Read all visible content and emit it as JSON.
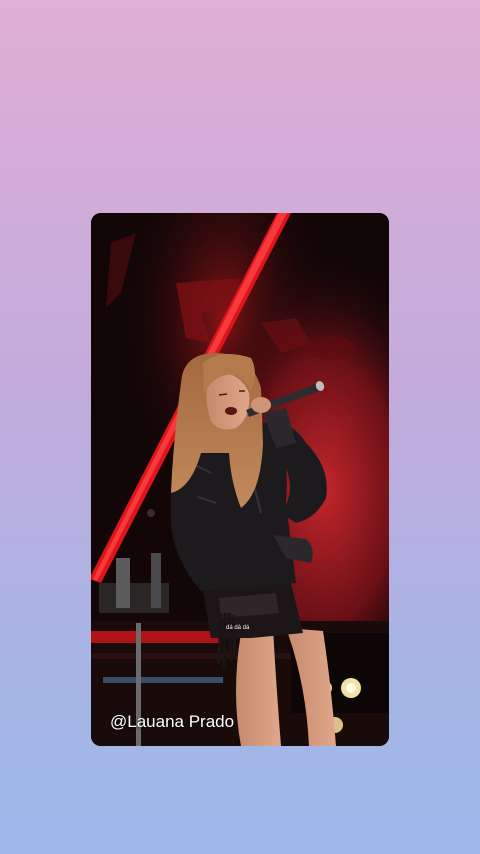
{
  "video": {
    "watermark": "@Lauana Prado",
    "caption": "dá dá dá"
  }
}
